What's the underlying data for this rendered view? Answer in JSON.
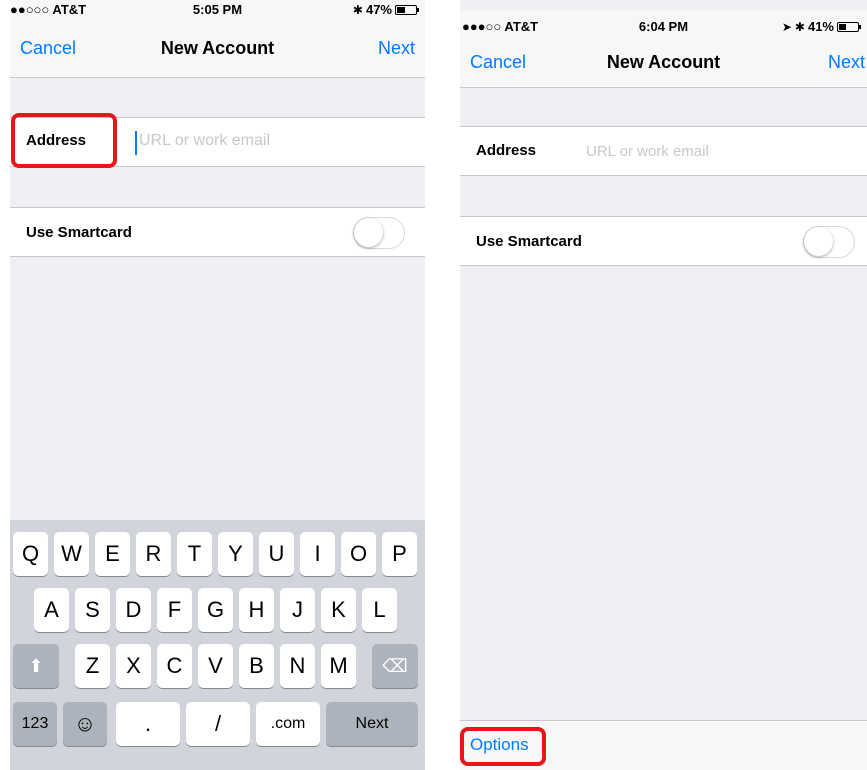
{
  "left_screen": {
    "status": {
      "carrier": "●●○○○ AT&T",
      "time": "5:05 PM",
      "battery_text": "47%",
      "battery_level": 0.47
    },
    "nav": {
      "cancel": "Cancel",
      "title": "New Account",
      "next": "Next"
    },
    "address": {
      "label": "Address",
      "placeholder": "URL or work email"
    },
    "smartcard": {
      "label": "Use Smartcard",
      "on": false
    },
    "keyboard": {
      "row1": [
        "Q",
        "W",
        "E",
        "R",
        "T",
        "Y",
        "U",
        "I",
        "O",
        "P"
      ],
      "row2": [
        "A",
        "S",
        "D",
        "F",
        "G",
        "H",
        "J",
        "K",
        "L"
      ],
      "row3": [
        "Z",
        "X",
        "C",
        "V",
        "B",
        "N",
        "M"
      ],
      "row4": {
        "num": "123",
        "emoji": "☺",
        "dot": ".",
        "slash": "/",
        "dotcom": ".com",
        "next": "Next"
      },
      "shift": "⬆",
      "delete": "⌫"
    }
  },
  "right_screen": {
    "status": {
      "carrier": "●●●○○ AT&T",
      "time": "6:04 PM",
      "battery_text": "41%",
      "battery_level": 0.41
    },
    "nav": {
      "cancel": "Cancel",
      "title": "New Account",
      "next": "Next"
    },
    "address": {
      "label": "Address",
      "placeholder": "URL or work email"
    },
    "smartcard": {
      "label": "Use Smartcard",
      "on": false
    },
    "toolbar": {
      "options": "Options"
    }
  },
  "colors": {
    "accent": "#007aff",
    "highlight": "#e8151b",
    "background": "#efeff4"
  }
}
